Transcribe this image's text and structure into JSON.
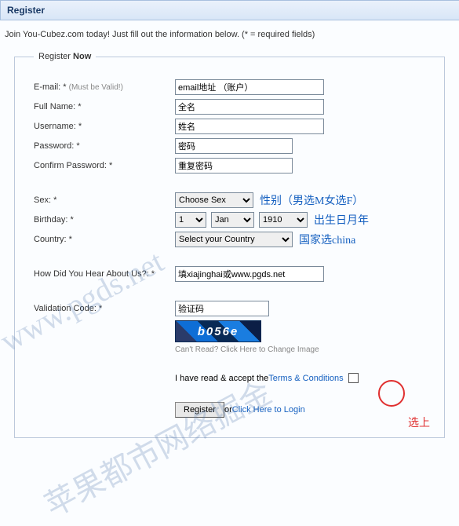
{
  "titleBar": "Register",
  "intro": "Join You-Cubez.com today! Just fill out the information below. (* = required fields)",
  "legend": {
    "prefix": "Register ",
    "bold": "Now"
  },
  "fields": {
    "email": {
      "label": "E-mail: *",
      "hint": "(Must be Valid!)",
      "value": "email地址 （账户）"
    },
    "fullname": {
      "label": "Full Name: *",
      "value": "全名"
    },
    "username": {
      "label": "Username: *",
      "value": "姓名"
    },
    "password": {
      "label": "Password: *",
      "value": "密码"
    },
    "confirm": {
      "label": "Confirm Password: *",
      "value": "重复密码"
    },
    "sex": {
      "label": "Sex: *",
      "selected": "Choose Sex",
      "ann": "性别（男选M女选F）"
    },
    "birthday": {
      "label": "Birthday: *",
      "day": "1",
      "month": "Jan",
      "year": "1910",
      "ann": "出生日月年"
    },
    "country": {
      "label": "Country: *",
      "selected": "Select your Country",
      "ann": "国家选china"
    },
    "hear": {
      "label": "How Did You Hear About Us?: *",
      "value": "填xiajinghai或www.pgds.net"
    },
    "validation": {
      "label": "Validation Code: *",
      "value": "验证码"
    }
  },
  "captcha": {
    "text": "b056e",
    "help": "Can't Read? Click Here to Change Image"
  },
  "terms": {
    "text": "I have read & accept the ",
    "link": "Terms & Conditions"
  },
  "buttons": {
    "register": "Register",
    "or": " or ",
    "login": "Click Here to Login"
  },
  "selectNote": "选上",
  "watermark1": "www.pgds.net",
  "watermark2": "苹果都市网络掘金"
}
